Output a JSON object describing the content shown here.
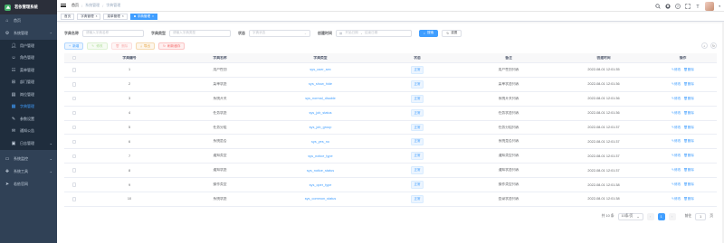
{
  "app": {
    "title": "若依管理系统"
  },
  "sidebar": {
    "items": [
      {
        "label": "首页",
        "icon": "home-icon"
      },
      {
        "label": "系统管理",
        "icon": "gear-icon",
        "expanded": true
      }
    ],
    "submenu": [
      {
        "label": "用户管理",
        "icon": "user-icon"
      },
      {
        "label": "角色管理",
        "icon": "people-icon"
      },
      {
        "label": "菜单管理",
        "icon": "tree-table-icon"
      },
      {
        "label": "部门管理",
        "icon": "tree-icon"
      },
      {
        "label": "岗位管理",
        "icon": "post-icon"
      },
      {
        "label": "字典管理",
        "icon": "dict-icon",
        "active": true
      },
      {
        "label": "参数设置",
        "icon": "edit-icon"
      },
      {
        "label": "通知公告",
        "icon": "message-icon"
      },
      {
        "label": "日志管理",
        "icon": "log-icon"
      }
    ],
    "bottom": [
      {
        "label": "系统监控",
        "icon": "monitor-icon"
      },
      {
        "label": "系统工具",
        "icon": "tool-icon"
      },
      {
        "label": "若依官网",
        "icon": "guide-icon"
      }
    ]
  },
  "navbar": {
    "breadcrumb": [
      "首页",
      "系统管理",
      "字典管理"
    ]
  },
  "tags": [
    {
      "label": "首页",
      "active": false
    },
    {
      "label": "字典管理",
      "active": false
    },
    {
      "label": "菜单管理",
      "active": false
    },
    {
      "label": "字典管理",
      "active": true
    }
  ],
  "search": {
    "dict_name_label": "字典名称",
    "dict_name_placeholder": "请输入字典名称",
    "dict_type_label": "字典类型",
    "dict_type_placeholder": "请输入字典类型",
    "status_label": "状态",
    "status_placeholder": "字典状态",
    "created_label": "创建时间",
    "start_placeholder": "开始日期",
    "range_sep": "-",
    "end_placeholder": "结束日期",
    "search_button": "搜索",
    "reset_button": "重置"
  },
  "toolbar": {
    "add": "新增",
    "edit": "修改",
    "delete": "删除",
    "export": "导出",
    "refresh_cache": "刷新缓存"
  },
  "table": {
    "headers": [
      "字典编号",
      "字典名称",
      "字典类型",
      "状态",
      "备注",
      "创建时间",
      "操作"
    ],
    "edit_label": "修改",
    "delete_label": "删除",
    "rows": [
      {
        "id": "1",
        "name": "用户性别",
        "type": "sys_user_sex",
        "status": "正常",
        "remark": "用户性别列表",
        "created": "2022-08-01 12:01:35"
      },
      {
        "id": "2",
        "name": "菜单状态",
        "type": "sys_show_hide",
        "status": "正常",
        "remark": "菜单状态列表",
        "created": "2022-08-01 12:01:36"
      },
      {
        "id": "3",
        "name": "系统开关",
        "type": "sys_normal_disable",
        "status": "正常",
        "remark": "系统开关列表",
        "created": "2022-08-01 12:01:36"
      },
      {
        "id": "4",
        "name": "任务状态",
        "type": "sys_job_status",
        "status": "正常",
        "remark": "任务状态列表",
        "created": "2022-08-01 12:01:36"
      },
      {
        "id": "5",
        "name": "任务分组",
        "type": "sys_job_group",
        "status": "正常",
        "remark": "任务分组列表",
        "created": "2022-08-01 12:01:37"
      },
      {
        "id": "6",
        "name": "系统是否",
        "type": "sys_yes_no",
        "status": "正常",
        "remark": "系统是否列表",
        "created": "2022-08-01 12:01:37"
      },
      {
        "id": "7",
        "name": "通知类型",
        "type": "sys_notice_type",
        "status": "正常",
        "remark": "通知类型列表",
        "created": "2022-08-01 12:01:37"
      },
      {
        "id": "8",
        "name": "通知状态",
        "type": "sys_notice_status",
        "status": "正常",
        "remark": "通知状态列表",
        "created": "2022-08-01 12:01:37"
      },
      {
        "id": "9",
        "name": "操作类型",
        "type": "sys_oper_type",
        "status": "正常",
        "remark": "操作类型列表",
        "created": "2022-08-01 12:01:38"
      },
      {
        "id": "10",
        "name": "系统状态",
        "type": "sys_common_status",
        "status": "正常",
        "remark": "登录状态列表",
        "created": "2022-08-01 12:01:38"
      }
    ]
  },
  "pagination": {
    "total_text": "共 10 条",
    "page_size": "10条/页",
    "current_page": "1",
    "goto_label": "前往",
    "goto_value": "1",
    "page_suffix": "页"
  },
  "colors": {
    "primary": "#409eff",
    "sidebar_bg": "#304156",
    "submenu_bg": "#1f2d3d"
  }
}
